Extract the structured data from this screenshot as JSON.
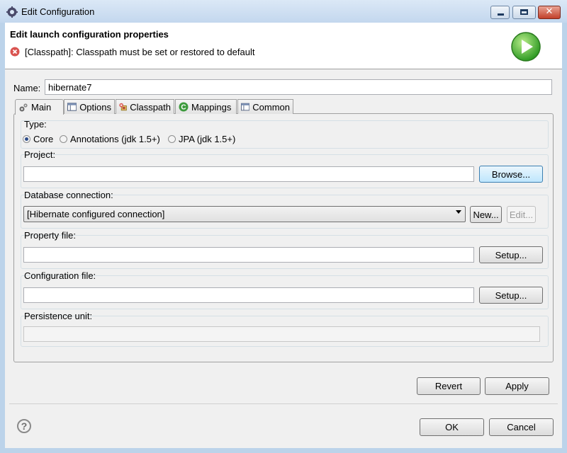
{
  "window": {
    "title": "Edit Configuration"
  },
  "header": {
    "title": "Edit launch configuration properties",
    "error_message": "[Classpath]: Classpath must be set or restored to default"
  },
  "name": {
    "label": "Name:",
    "value": "hibernate7"
  },
  "tabs": [
    {
      "label": "Main",
      "icon": "main-config-icon",
      "selected": true
    },
    {
      "label": "Options",
      "icon": "options-table-icon"
    },
    {
      "label": "Classpath",
      "icon": "classpath-error-icon"
    },
    {
      "label": "Mappings",
      "icon": "mappings-c-icon"
    },
    {
      "label": "Common",
      "icon": "common-table-icon"
    }
  ],
  "main": {
    "type": {
      "label": "Type:",
      "options": [
        {
          "label": "Core",
          "selected": true
        },
        {
          "label": "Annotations (jdk 1.5+)",
          "selected": false
        },
        {
          "label": "JPA (jdk 1.5+)",
          "selected": false
        }
      ]
    },
    "project": {
      "label": "Project:",
      "value": "",
      "button": "Browse..."
    },
    "database": {
      "label": "Database connection:",
      "value": "[Hibernate configured connection]",
      "new_button": "New...",
      "edit_button": "Edit..."
    },
    "property_file": {
      "label": "Property file:",
      "value": "",
      "button": "Setup..."
    },
    "configuration_file": {
      "label": "Configuration file:",
      "value": "",
      "button": "Setup..."
    },
    "persistence_unit": {
      "label": "Persistence unit:",
      "value": ""
    }
  },
  "actions": {
    "revert": "Revert",
    "apply": "Apply",
    "ok": "OK",
    "cancel": "Cancel"
  },
  "help": {
    "icon": "help-icon",
    "glyph": "?"
  }
}
